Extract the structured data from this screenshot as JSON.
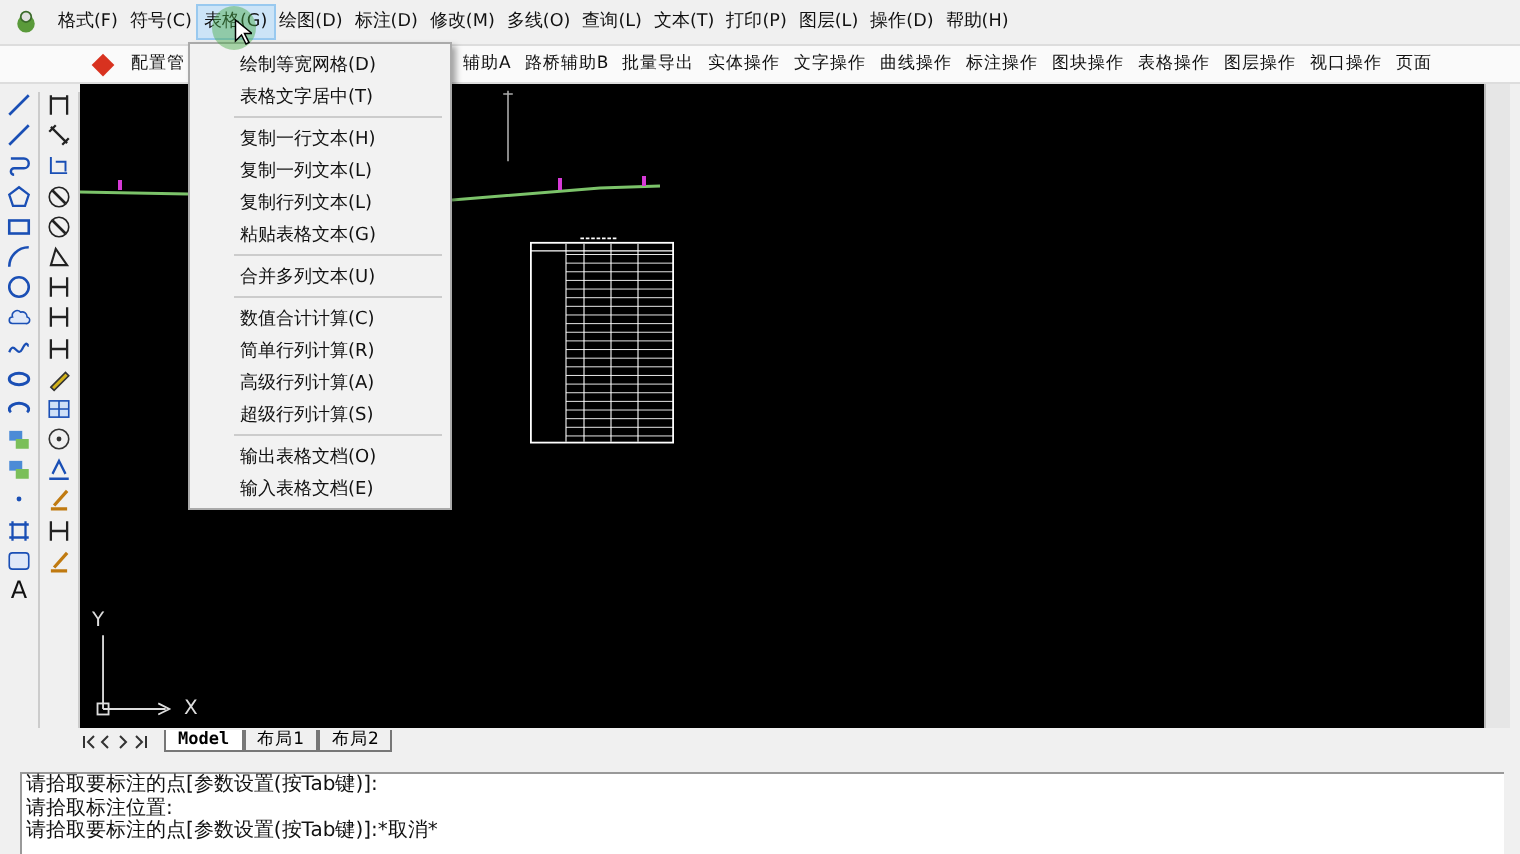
{
  "menubar": {
    "items": [
      {
        "label": "格式(F)",
        "selected": false
      },
      {
        "label": "符号(C)",
        "selected": false
      },
      {
        "label": "表格(G)",
        "selected": true
      },
      {
        "label": "绘图(D)",
        "selected": false
      },
      {
        "label": "标注(D)",
        "selected": false
      },
      {
        "label": "修改(M)",
        "selected": false
      },
      {
        "label": "多线(O)",
        "selected": false
      },
      {
        "label": "查询(L)",
        "selected": false
      },
      {
        "label": "文本(T)",
        "selected": false
      },
      {
        "label": "打印(P)",
        "selected": false
      },
      {
        "label": "图层(L)",
        "selected": false
      },
      {
        "label": "操作(D)",
        "selected": false
      },
      {
        "label": "帮助(H)",
        "selected": false
      }
    ]
  },
  "toolbar": {
    "items": [
      "配置管",
      "辅助A",
      "路桥辅助B",
      "批量导出",
      "实体操作",
      "文字操作",
      "曲线操作",
      "标注操作",
      "图块操作",
      "表格操作",
      "图层操作",
      "视口操作",
      "页面"
    ]
  },
  "dropdown_menu": {
    "groups": [
      [
        "绘制等宽网格(D)",
        "表格文字居中(T)"
      ],
      [
        "复制一行文本(H)",
        "复制一列文本(L)",
        "复制行列文本(L)",
        "粘贴表格文本(G)"
      ],
      [
        "合并多列文本(U)"
      ],
      [
        "数值合计计算(C)",
        "简单行列计算(R)",
        "高级行列计算(A)",
        "超级行列计算(S)"
      ],
      [
        "输出表格文档(O)",
        "输入表格文档(E)"
      ]
    ]
  },
  "left_toolbar": {
    "text_tool": "A"
  },
  "canvas": {
    "axis_y": "Y",
    "axis_x": "X"
  },
  "layout_tabs": [
    {
      "label": "Model",
      "selected": true
    },
    {
      "label": "布局1",
      "selected": false
    },
    {
      "label": "布局2",
      "selected": false
    }
  ],
  "command_lines": [
    "请拾取要标注的点[参数设置(按Tab键)]:",
    "请拾取标注位置:",
    "请拾取要标注的点[参数设置(按Tab键)]:*取消*"
  ]
}
